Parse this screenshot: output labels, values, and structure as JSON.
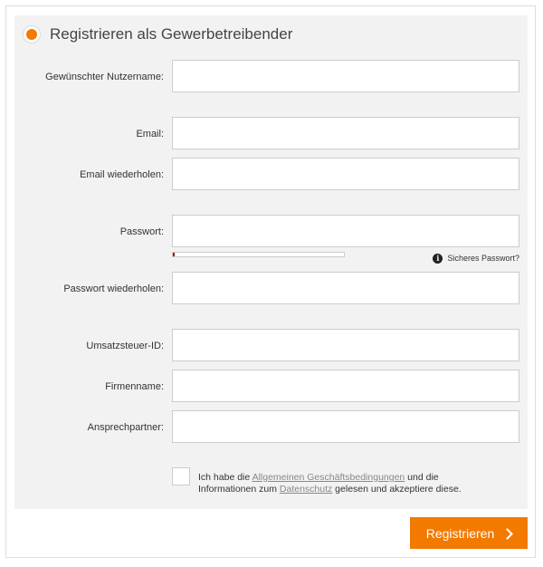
{
  "form": {
    "title": "Registrieren als Gewerbetreibender",
    "fields": [
      {
        "label": "Gewünschter Nutzername:",
        "value": ""
      },
      {
        "label": "Email:",
        "value": ""
      },
      {
        "label": "Email wiederholen:",
        "value": ""
      },
      {
        "label": "Passwort:",
        "value": ""
      },
      {
        "label": "Passwort wiederholen:",
        "value": ""
      },
      {
        "label": "Umsatzsteuer-ID:",
        "value": ""
      },
      {
        "label": "Firmenname:",
        "value": ""
      },
      {
        "label": "Ansprechpartner:",
        "value": ""
      }
    ],
    "password_strength": 0.01,
    "password_hint": "Sicheres Passwort?",
    "consent": {
      "text_before": "Ich habe die ",
      "terms_link": "Allgemeinen Geschäftsbedingungen",
      "text_middle": " und die Informationen zum ",
      "privacy_link": "Datenschutz",
      "text_after": " gelesen und akzeptiere diese.",
      "checked": false
    },
    "submit_label": "Registrieren"
  },
  "colors": {
    "accent": "#f37a00",
    "panel_bg": "#f2f2f2",
    "strength_weak": "#c00000"
  }
}
